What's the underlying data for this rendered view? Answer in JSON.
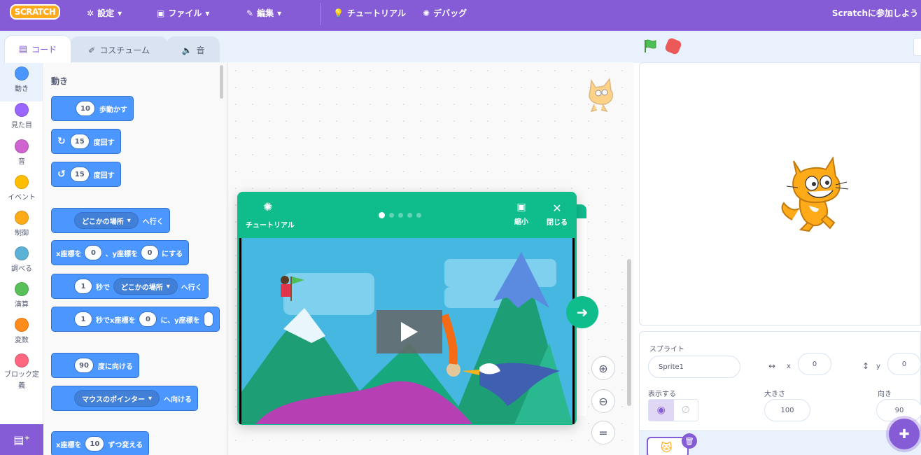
{
  "menubar": {
    "logo": "SCRATCH",
    "settings": "設定",
    "file": "ファイル",
    "edit": "編集",
    "tutorials": "チュートリアル",
    "debug": "デバッグ",
    "join": "Scratchに参加しよう"
  },
  "tabs": {
    "code": "コード",
    "costumes": "コスチューム",
    "sounds": "音"
  },
  "categories": [
    {
      "label": "動き",
      "color": "#4c97ff"
    },
    {
      "label": "見た目",
      "color": "#9966ff"
    },
    {
      "label": "音",
      "color": "#cf63cf"
    },
    {
      "label": "イベント",
      "color": "#ffbf00"
    },
    {
      "label": "制御",
      "color": "#ffab19"
    },
    {
      "label": "調べる",
      "color": "#5cb1d6"
    },
    {
      "label": "演算",
      "color": "#59c059"
    },
    {
      "label": "変数",
      "color": "#ff8c1a"
    },
    {
      "label": "ブロック定義",
      "color": "#ff6680"
    }
  ],
  "flyout": {
    "title": "動き",
    "move": {
      "value": "10",
      "text": "歩動かす"
    },
    "turn_right": {
      "value": "15",
      "text": "度回す"
    },
    "turn_left": {
      "value": "15",
      "text": "度回す"
    },
    "goto": {
      "menu": "どこかの場所",
      "text": "へ行く"
    },
    "goto_xy": {
      "x_label": "x座標を",
      "x": "0",
      "sep": "、y座標を",
      "y": "0",
      "text": "にする"
    },
    "glide": {
      "secs": "1",
      "text1": "秒で",
      "menu": "どこかの場所",
      "text2": "へ行く"
    },
    "glide_xy": {
      "secs": "1",
      "text1": "秒でx座標を",
      "x": "0",
      "text2": "に、y座標を"
    },
    "point_dir": {
      "value": "90",
      "text": "度に向ける"
    },
    "point_towards": {
      "menu": "マウスのポインター",
      "text": "へ向ける"
    },
    "change_x": {
      "label": "x座標を",
      "value": "10",
      "text": "ずつ変える"
    }
  },
  "tutorial": {
    "label": "チュートリアル",
    "shrink": "縮小",
    "close": "閉じる",
    "step_dots": 5,
    "current_step": 1
  },
  "sprite_info": {
    "sprite_label": "スプライト",
    "sprite_name": "Sprite1",
    "x_label": "x",
    "x": "0",
    "y_label": "y",
    "y": "0",
    "show_label": "表示する",
    "size_label": "大きさ",
    "size": "100",
    "direction_label": "向き",
    "direction": "90"
  },
  "colors": {
    "menubar": "#855cd6",
    "motion": "#4c97ff",
    "tutorial": "#0fbd8c",
    "stop": "#ec5959",
    "flag": "#4cbf56"
  }
}
